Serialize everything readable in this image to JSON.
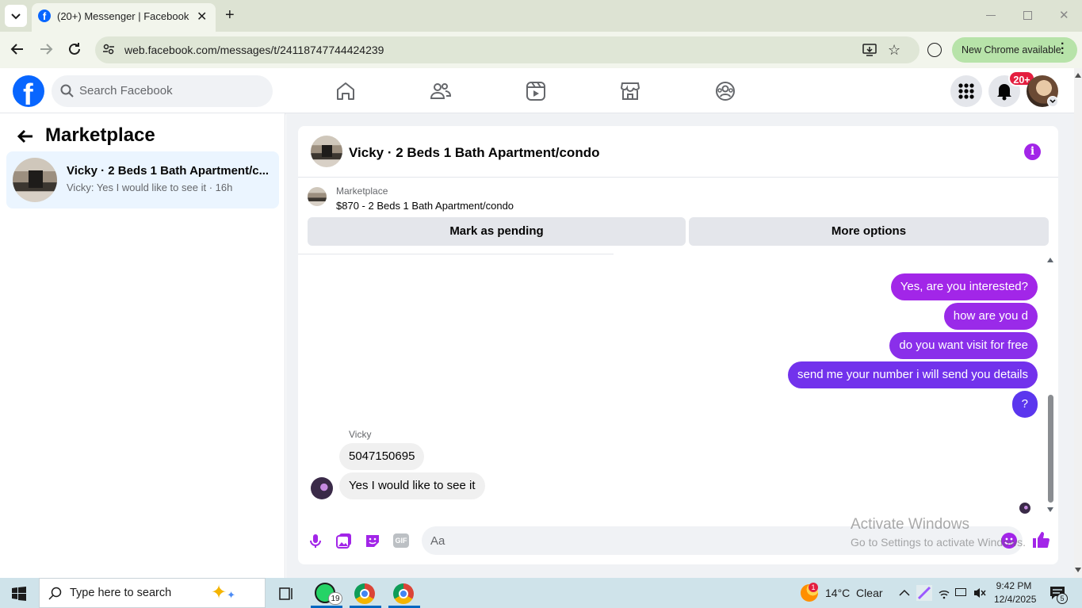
{
  "browser": {
    "tab_title": "(20+) Messenger | Facebook",
    "url": "web.facebook.com/messages/t/24118747744424239",
    "new_chrome_label": "New Chrome available"
  },
  "facebook": {
    "search_placeholder": "Search Facebook",
    "notification_badge": "20+",
    "nav_icons": [
      "home-icon",
      "friends-icon",
      "video-icon",
      "marketplace-icon",
      "groups-icon"
    ]
  },
  "sidebar": {
    "title": "Marketplace",
    "conversation": {
      "name": "Vicky · 2 Beds 1 Bath Apartment/c...",
      "preview": "Vicky: Yes I would like to see it · 16h"
    }
  },
  "chat": {
    "title": "Vicky · 2 Beds 1 Bath Apartment/condo",
    "listing_label": "Marketplace",
    "listing_price": "$870 - 2 Beds 1 Bath Apartment/condo",
    "mark_pending_label": "Mark as pending",
    "more_options_label": "More options",
    "outgoing": [
      {
        "text": "Yes, are you interested?",
        "color": "#a226e8"
      },
      {
        "text": "how are you d",
        "color": "#9a2ae9"
      },
      {
        "text": "do you want visit for free",
        "color": "#8a2fea"
      },
      {
        "text": "send me your number i will send you details",
        "color": "#7232ec"
      },
      {
        "text": "?",
        "color": "#5b36ee"
      }
    ],
    "sender_name": "Vicky",
    "incoming": [
      "5047150695",
      "Yes I would like to see it"
    ],
    "composer_placeholder": "Aa",
    "accent": "#a225e8"
  },
  "watermark": {
    "line1": "Activate Windows",
    "line2": "Go to Settings to activate Windows."
  },
  "taskbar": {
    "search_placeholder": "Type here to search",
    "whatsapp_badge": "19",
    "weather": "14°C  Clear",
    "weather_badge": "1",
    "time": "9:42 PM",
    "date": "12/4/2025",
    "notifications_count": "5"
  }
}
